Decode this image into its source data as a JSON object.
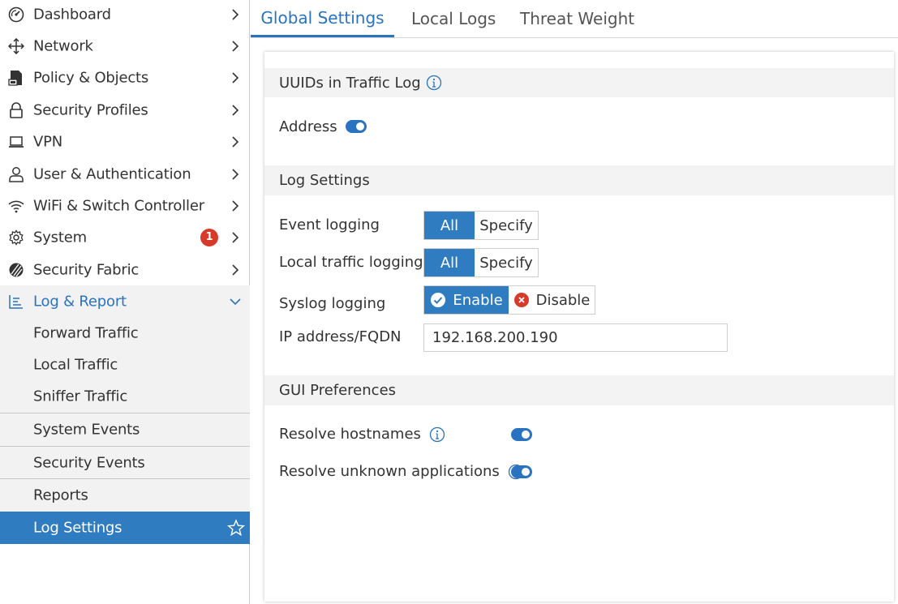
{
  "sidebar": {
    "items": [
      {
        "label": "Dashboard",
        "icon": "dashboard-icon"
      },
      {
        "label": "Network",
        "icon": "network-move-icon"
      },
      {
        "label": "Policy & Objects",
        "icon": "policy-icon"
      },
      {
        "label": "Security Profiles",
        "icon": "lock-icon"
      },
      {
        "label": "VPN",
        "icon": "laptop-icon"
      },
      {
        "label": "User & Authentication",
        "icon": "user-icon"
      },
      {
        "label": "WiFi & Switch Controller",
        "icon": "wifi-icon"
      },
      {
        "label": "System",
        "icon": "gear-icon",
        "badge": "1"
      },
      {
        "label": "Security Fabric",
        "icon": "fabric-icon"
      },
      {
        "label": "Log & Report",
        "icon": "log-report-icon"
      }
    ],
    "subitems": [
      {
        "label": "Forward Traffic"
      },
      {
        "label": "Local Traffic"
      },
      {
        "label": "Sniffer Traffic"
      },
      {
        "label": "System Events"
      },
      {
        "label": "Security Events"
      },
      {
        "label": "Reports"
      },
      {
        "label": "Log Settings"
      }
    ]
  },
  "tabs": [
    {
      "label": "Global Settings"
    },
    {
      "label": "Local Logs"
    },
    {
      "label": "Threat Weight"
    }
  ],
  "sections": {
    "uuid": {
      "title": "UUIDs in Traffic Log",
      "address_label": "Address"
    },
    "log": {
      "title": "Log Settings",
      "event_label": "Event logging",
      "local_label": "Local traffic logging",
      "syslog_label": "Syslog logging",
      "ip_label": "IP address/FQDN",
      "all": "All",
      "specify": "Specify",
      "enable": "Enable",
      "disable": "Disable",
      "ip_value": "192.168.200.190"
    },
    "gui": {
      "title": "GUI Preferences",
      "hostnames_label": "Resolve hostnames",
      "unknown_apps_label": "Resolve unknown applications"
    }
  },
  "colors": {
    "accent": "#2f7cc0",
    "badge": "#d83a2a",
    "disable": "#d83a2a"
  }
}
